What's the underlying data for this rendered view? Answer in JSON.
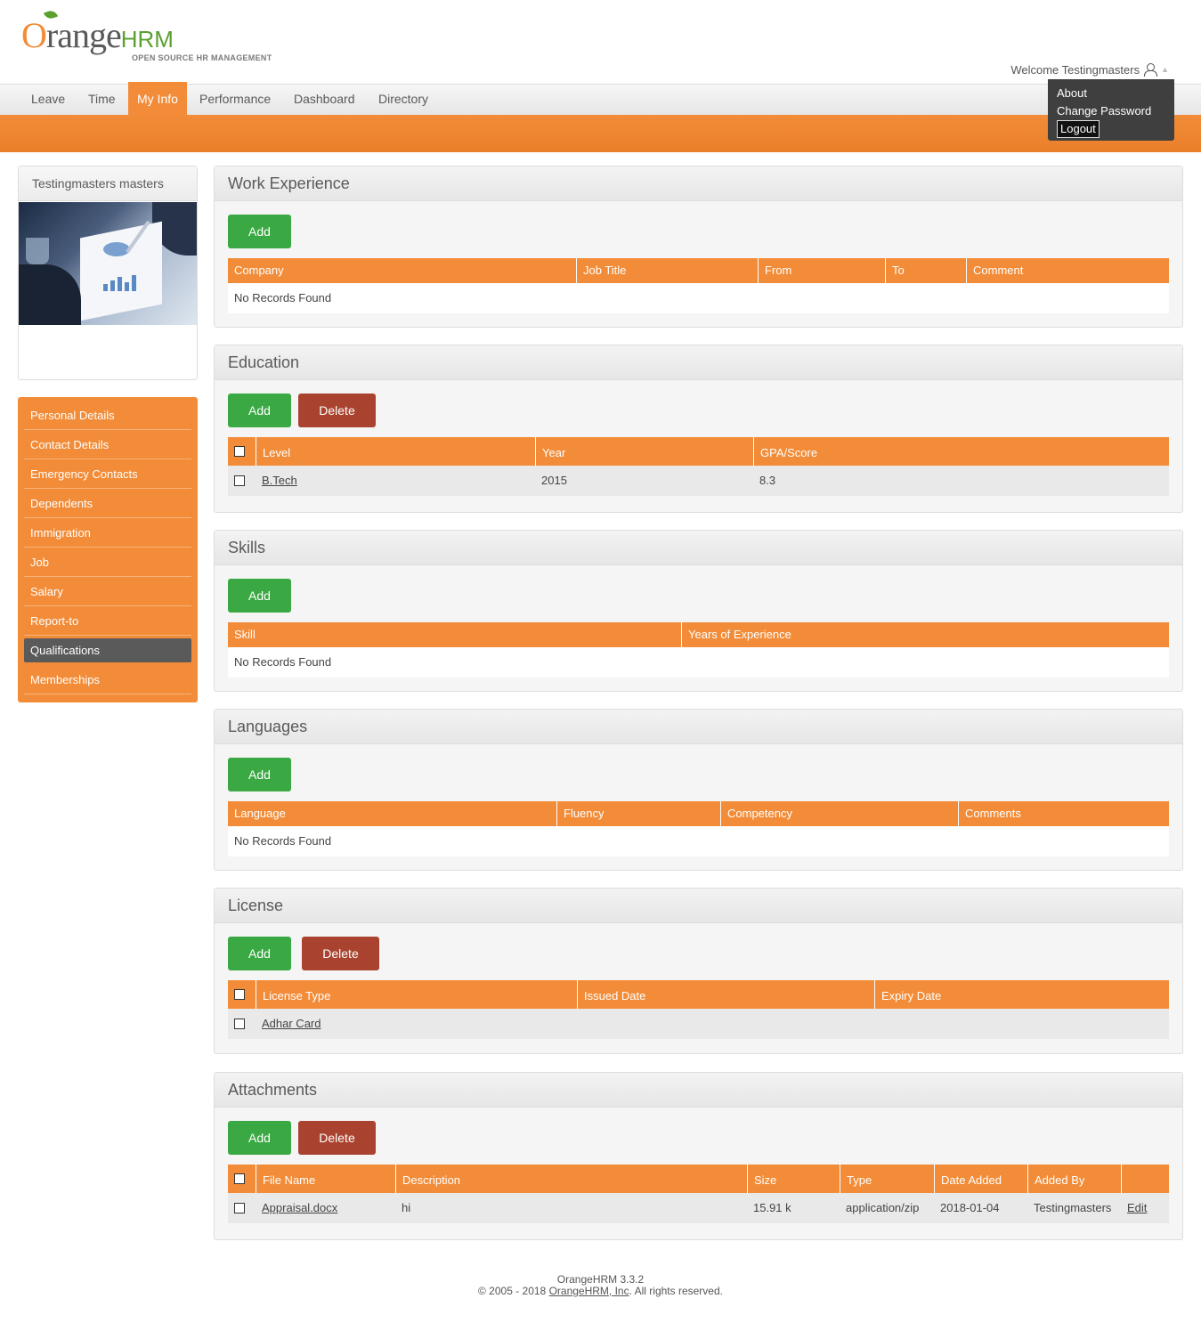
{
  "brand": {
    "logo_main": "range",
    "logo_o": "O",
    "logo_hrm": "HRM",
    "logo_tagline": "OPEN SOURCE HR MANAGEMENT",
    "accent": "#f28c38",
    "green": "#3aa843",
    "red": "#a9432f"
  },
  "header": {
    "welcome": "Welcome Testingmasters",
    "user_menu": [
      "About",
      "Change Password",
      "Logout"
    ]
  },
  "nav": {
    "tabs": [
      "Leave",
      "Time",
      "My Info",
      "Performance",
      "Dashboard",
      "Directory"
    ],
    "active": "My Info"
  },
  "sidebar": {
    "profile_name": "Testingmasters masters",
    "items": [
      "Personal Details",
      "Contact Details",
      "Emergency Contacts",
      "Dependents",
      "Immigration",
      "Job",
      "Salary",
      "Report-to",
      "Qualifications",
      "Memberships"
    ],
    "active": "Qualifications"
  },
  "buttons": {
    "add": "Add",
    "delete": "Delete"
  },
  "work_experience": {
    "title": "Work Experience",
    "columns": [
      "Company",
      "Job Title",
      "From",
      "To",
      "Comment"
    ],
    "empty": "No Records Found"
  },
  "education": {
    "title": "Education",
    "columns": [
      "Level",
      "Year",
      "GPA/Score"
    ],
    "rows": [
      {
        "level": "B.Tech",
        "year": "2015",
        "score": "8.3"
      }
    ]
  },
  "skills": {
    "title": "Skills",
    "columns": [
      "Skill",
      "Years of Experience"
    ],
    "empty": "No Records Found"
  },
  "languages": {
    "title": "Languages",
    "columns": [
      "Language",
      "Fluency",
      "Competency",
      "Comments"
    ],
    "empty": "No Records Found"
  },
  "license": {
    "title": "License",
    "columns": [
      "License Type",
      "Issued Date",
      "Expiry Date"
    ],
    "rows": [
      {
        "type": "Adhar Card"
      }
    ]
  },
  "attachments": {
    "title": "Attachments",
    "columns": [
      "File Name",
      "Description",
      "Size",
      "Type",
      "Date Added",
      "Added By"
    ],
    "rows": [
      {
        "file": "Appraisal.docx",
        "description": "hi",
        "size": "15.91 k",
        "type": "application/zip",
        "date": "2018-01-04",
        "added_by": "Testingmasters",
        "edit": "Edit"
      }
    ]
  },
  "footer": {
    "version": "OrangeHRM 3.3.2",
    "copyright_prefix": "© 2005 - 2018 ",
    "company_link": "OrangeHRM, Inc",
    "copyright_suffix": ". All rights reserved."
  }
}
